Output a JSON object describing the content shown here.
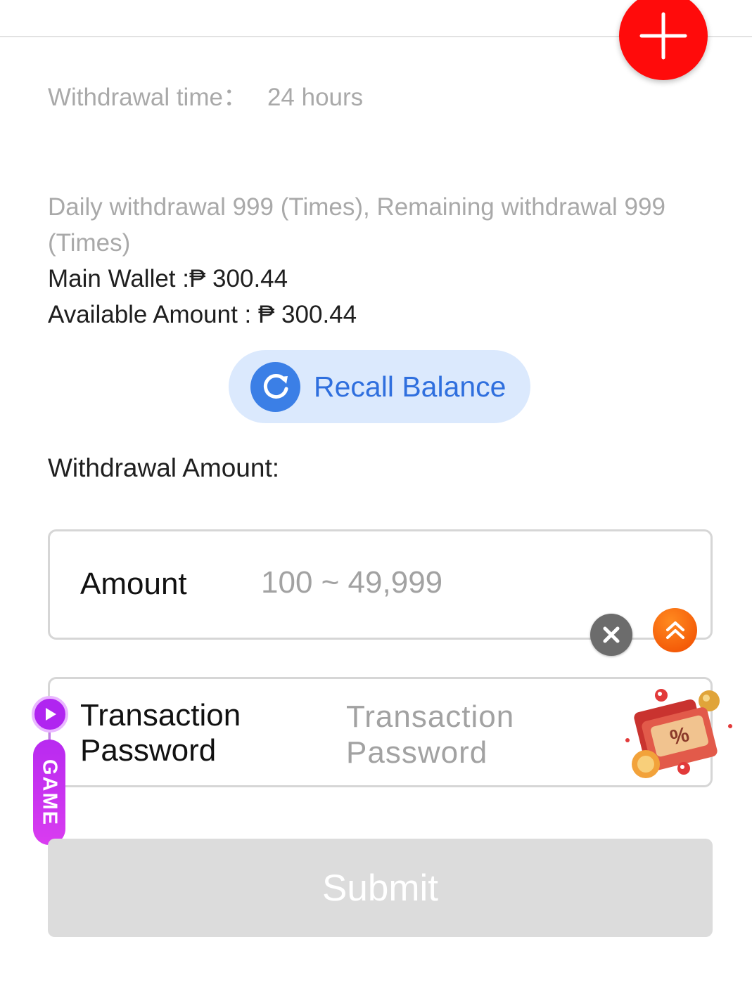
{
  "header": {
    "add_icon": "plus-icon",
    "accent_color": "#ff0b0b"
  },
  "withdrawal_info": {
    "time_label": "Withdrawal time：",
    "time_value": "24 hours",
    "daily_limit_text": "Daily withdrawal 999 (Times), Remaining withdrawal 999 (Times)"
  },
  "wallet": {
    "main_wallet_text": "Main Wallet :₱ 300.44",
    "available_amount_text": "Available Amount : ₱ 300.44"
  },
  "recall": {
    "label": "Recall Balance",
    "icon": "refresh-icon"
  },
  "form": {
    "amount_section_title": "Withdrawal Amount:",
    "amount_label": "Amount",
    "amount_placeholder": "100 ~ 49,999",
    "amount_value": "",
    "password_label": "Transaction Password",
    "password_placeholder": "Transaction Password",
    "password_value": "",
    "submit_label": "Submit"
  },
  "floating": {
    "clear_icon": "close-icon",
    "scroll_top_icon": "double-chevron-up-icon",
    "game_label": "GAME",
    "game_icon": "play-icon",
    "promo_icon": "discount-gift-icon"
  }
}
